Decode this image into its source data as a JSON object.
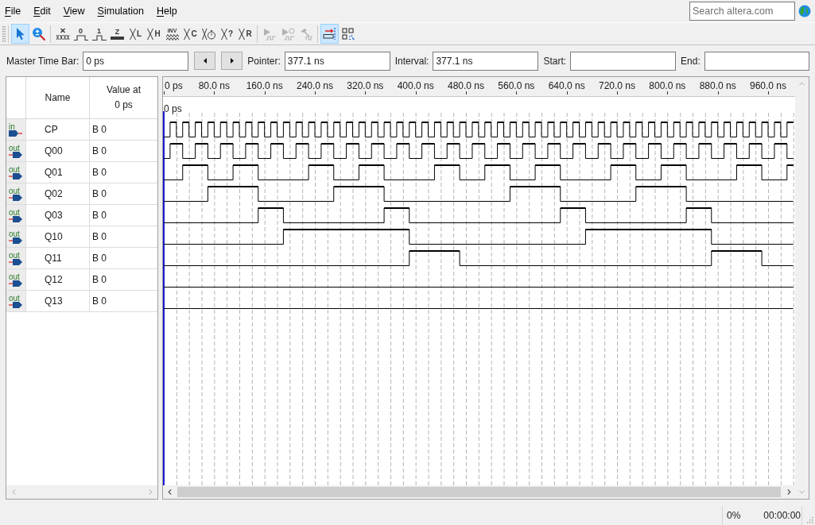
{
  "menu": [
    {
      "label": "File",
      "mnemonic": true
    },
    {
      "label": "Edit",
      "mnemonic": true
    },
    {
      "label": "View",
      "mnemonic": true
    },
    {
      "label": "Simulation",
      "mnemonic": true
    },
    {
      "label": "Help",
      "mnemonic": true
    }
  ],
  "search": {
    "placeholder": "Search altera.com"
  },
  "toolbar": [
    {
      "buttons": [
        {
          "kind": "select",
          "on": true,
          "disabled": false
        },
        {
          "kind": "zoom",
          "on": false,
          "disabled": false
        }
      ]
    },
    {
      "buttons": [
        {
          "kind": "uninitialized",
          "on": false,
          "disabled": false
        },
        {
          "kind": "force_low",
          "glyph": "0",
          "on": false,
          "disabled": false
        },
        {
          "kind": "force_high",
          "glyph": "1",
          "on": false,
          "disabled": false
        },
        {
          "kind": "high_impedance",
          "glyph": "Z",
          "on": false,
          "disabled": false
        },
        {
          "kind": "bus_value",
          "glyph": "L",
          "on": false,
          "disabled": false
        },
        {
          "kind": "bus_value",
          "glyph": "H",
          "on": false,
          "disabled": false
        },
        {
          "kind": "invert",
          "glyph": "INV",
          "on": false,
          "disabled": false
        },
        {
          "kind": "bus_value",
          "glyph": "C",
          "on": false,
          "disabled": false
        },
        {
          "kind": "clock_value",
          "on": false,
          "disabled": false
        },
        {
          "kind": "bus_value",
          "glyph": "?",
          "on": false,
          "disabled": false
        },
        {
          "kind": "bus_value",
          "glyph": "R",
          "on": false,
          "disabled": false
        }
      ]
    },
    {
      "buttons": [
        {
          "kind": "run",
          "on": false,
          "disabled": true
        },
        {
          "kind": "run_timed",
          "on": false,
          "disabled": true
        },
        {
          "kind": "netlist",
          "on": false,
          "disabled": true
        }
      ]
    },
    {
      "buttons": [
        {
          "kind": "snap",
          "on": true,
          "disabled": false
        },
        {
          "kind": "grid",
          "on": false,
          "disabled": false
        }
      ]
    }
  ],
  "time_bar": [
    {
      "kind": "field",
      "label": "Master Time Bar:",
      "value": "0 ps"
    },
    {
      "kind": "step_back"
    },
    {
      "kind": "step_forward"
    },
    {
      "kind": "field",
      "label": "Pointer:",
      "value": "377.1 ns"
    },
    {
      "kind": "field",
      "label": "Interval:",
      "value": "377.1 ns"
    },
    {
      "kind": "field",
      "label": "Start:"
    },
    {
      "kind": "field",
      "label": "End:"
    }
  ],
  "signal_list": {
    "name_header": "Name",
    "value_header": "Value at",
    "value_header_time": "0 ps",
    "signals": [
      {
        "kind": "input",
        "io_label": "in",
        "name": "CP",
        "value": "B 0"
      },
      {
        "kind": "output",
        "io_label": "out",
        "name": "Q00",
        "value": "B 0"
      },
      {
        "kind": "output",
        "io_label": "out",
        "name": "Q01",
        "value": "B 0"
      },
      {
        "kind": "output",
        "io_label": "out",
        "name": "Q02",
        "value": "B 0"
      },
      {
        "kind": "output",
        "io_label": "out",
        "name": "Q03",
        "value": "B 0"
      },
      {
        "kind": "output",
        "io_label": "out",
        "name": "Q10",
        "value": "B 0"
      },
      {
        "kind": "output",
        "io_label": "out",
        "name": "Q11",
        "value": "B 0"
      },
      {
        "kind": "output",
        "io_label": "out",
        "name": "Q12",
        "value": "B 0"
      },
      {
        "kind": "output",
        "io_label": "out",
        "name": "Q13",
        "value": "B 0"
      }
    ]
  },
  "waveform_view": {
    "time_bar_label": "0 ps",
    "ruler_ticks": [
      "0 ps",
      "80.0 ns",
      "160.0 ns",
      "240.0 ns",
      "320.0 ns",
      "400.0 ns",
      "480.0 ns",
      "560.0 ns",
      "640.0 ns",
      "720.0 ns",
      "800.0 ns",
      "880.0 ns",
      "960.0 ns"
    ]
  },
  "status_bar": {
    "progress": "0%",
    "elapsed": "00:00:00"
  }
}
